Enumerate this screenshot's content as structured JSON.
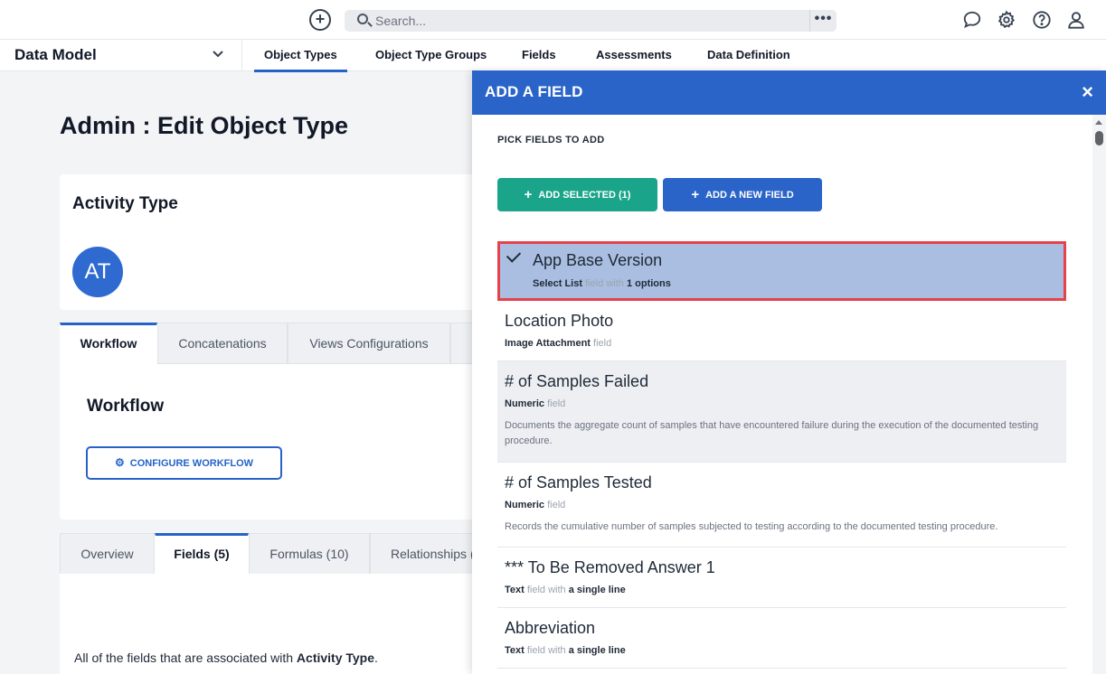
{
  "topbar": {
    "search_placeholder": "Search...",
    "more_label": "•••"
  },
  "nav": {
    "module": "Data Model",
    "tabs": [
      "Object Types",
      "Object Type Groups",
      "Fields",
      "Assessments",
      "Data Definition"
    ],
    "active_tab": "Object Types"
  },
  "main": {
    "page_title": "Admin : Edit Object Type",
    "object_name": "Activity Type",
    "avatar_initials": "AT",
    "tabs": [
      "Workflow",
      "Concatenations",
      "Views Configurations"
    ],
    "active_tab": "Workflow",
    "workflow_title": "Workflow",
    "configure_button": "CONFIGURE WORKFLOW",
    "bottom_tabs": [
      "Overview",
      "Fields (5)",
      "Formulas (10)",
      "Relationships ("
    ],
    "bottom_active_tab": "Fields (5)",
    "fields_text_prefix": "All of the fields that are associated with ",
    "fields_text_object": "Activity Type",
    "fields_text_suffix": "."
  },
  "panel": {
    "title": "ADD A FIELD",
    "close": "×",
    "pick_label": "PICK FIELDS TO ADD",
    "add_selected_button": "ADD SELECTED (1)",
    "add_new_button": "ADD A NEW FIELD",
    "fields": [
      {
        "name": "App Base Version",
        "type": "Select List",
        "suffix": "field with",
        "detail": "1 options",
        "selected": true
      },
      {
        "name": "Location Photo",
        "type": "Image Attachment",
        "suffix": "field",
        "detail": ""
      },
      {
        "name": "# of Samples Failed",
        "type": "Numeric",
        "suffix": "field",
        "detail": "",
        "description": "Documents the aggregate count of samples that have encountered failure during the execution of the documented testing procedure."
      },
      {
        "name": "# of Samples Tested",
        "type": "Numeric",
        "suffix": "field",
        "detail": "",
        "description": "Records the cumulative number of samples subjected to testing according to the documented testing procedure."
      },
      {
        "name": "*** To Be Removed Answer 1",
        "type": "Text",
        "suffix": "field with",
        "detail": "a single line"
      },
      {
        "name": "Abbreviation",
        "type": "Text",
        "suffix": "field with",
        "detail": "a single line"
      }
    ]
  },
  "colors": {
    "primary": "#2b64c8",
    "success": "#1aa58a",
    "selection_highlight": "#a9bee0",
    "selection_border": "#e5424b"
  },
  "icons": {
    "create": "plus-circle-icon",
    "search": "search-icon",
    "chat": "chat-bubble-icon",
    "settings": "gear-icon",
    "help": "help-icon",
    "user": "user-icon"
  }
}
